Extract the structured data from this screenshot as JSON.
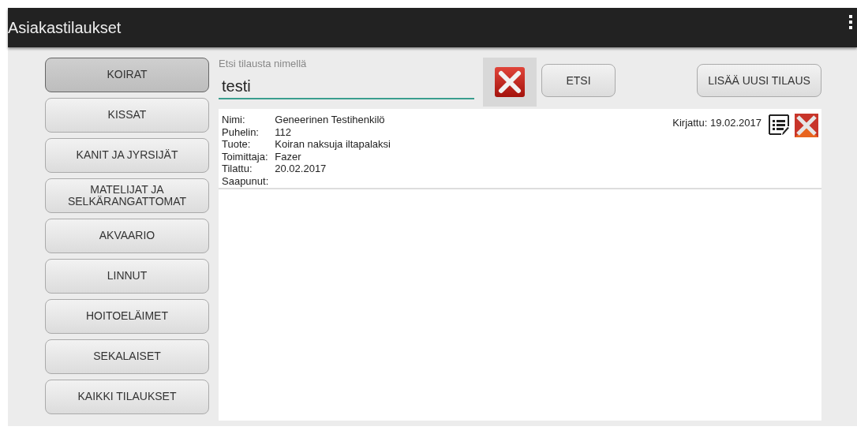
{
  "window": {
    "title": "Asiakastilaukset"
  },
  "sidebar": {
    "items": [
      {
        "label": "KOIRAT",
        "selected": true
      },
      {
        "label": "KISSAT",
        "selected": false
      },
      {
        "label": "KANIT JA JYRSIJÄT",
        "selected": false
      },
      {
        "label": "MATELIJAT JA SELKÄRANGATTOMAT",
        "selected": false
      },
      {
        "label": "AKVAARIO",
        "selected": false
      },
      {
        "label": "LINNUT",
        "selected": false
      },
      {
        "label": "HOITOELÄIMET",
        "selected": false
      },
      {
        "label": "SEKALAISET",
        "selected": false
      },
      {
        "label": "KAIKKI TILAUKSET",
        "selected": false
      }
    ]
  },
  "search": {
    "label": "Etsi tilausta nimellä",
    "value": "testi",
    "search_button": "ETSI"
  },
  "add_button": "LISÄÄ UUSI TILAUS",
  "orders": [
    {
      "registered": "Kirjattu: 19.02.2017",
      "fields": [
        {
          "label": "Nimi:",
          "value": "Geneerinen Testihenkilö"
        },
        {
          "label": "Puhelin:",
          "value": "112"
        },
        {
          "label": "Tuote:",
          "value": "Koiran naksuja iltapalaksi"
        },
        {
          "label": "Toimittaja:",
          "value": "Fazer"
        },
        {
          "label": "Tilattu:",
          "value": "20.02.2017"
        },
        {
          "label": "Saapunut:"
        }
      ]
    }
  ]
}
